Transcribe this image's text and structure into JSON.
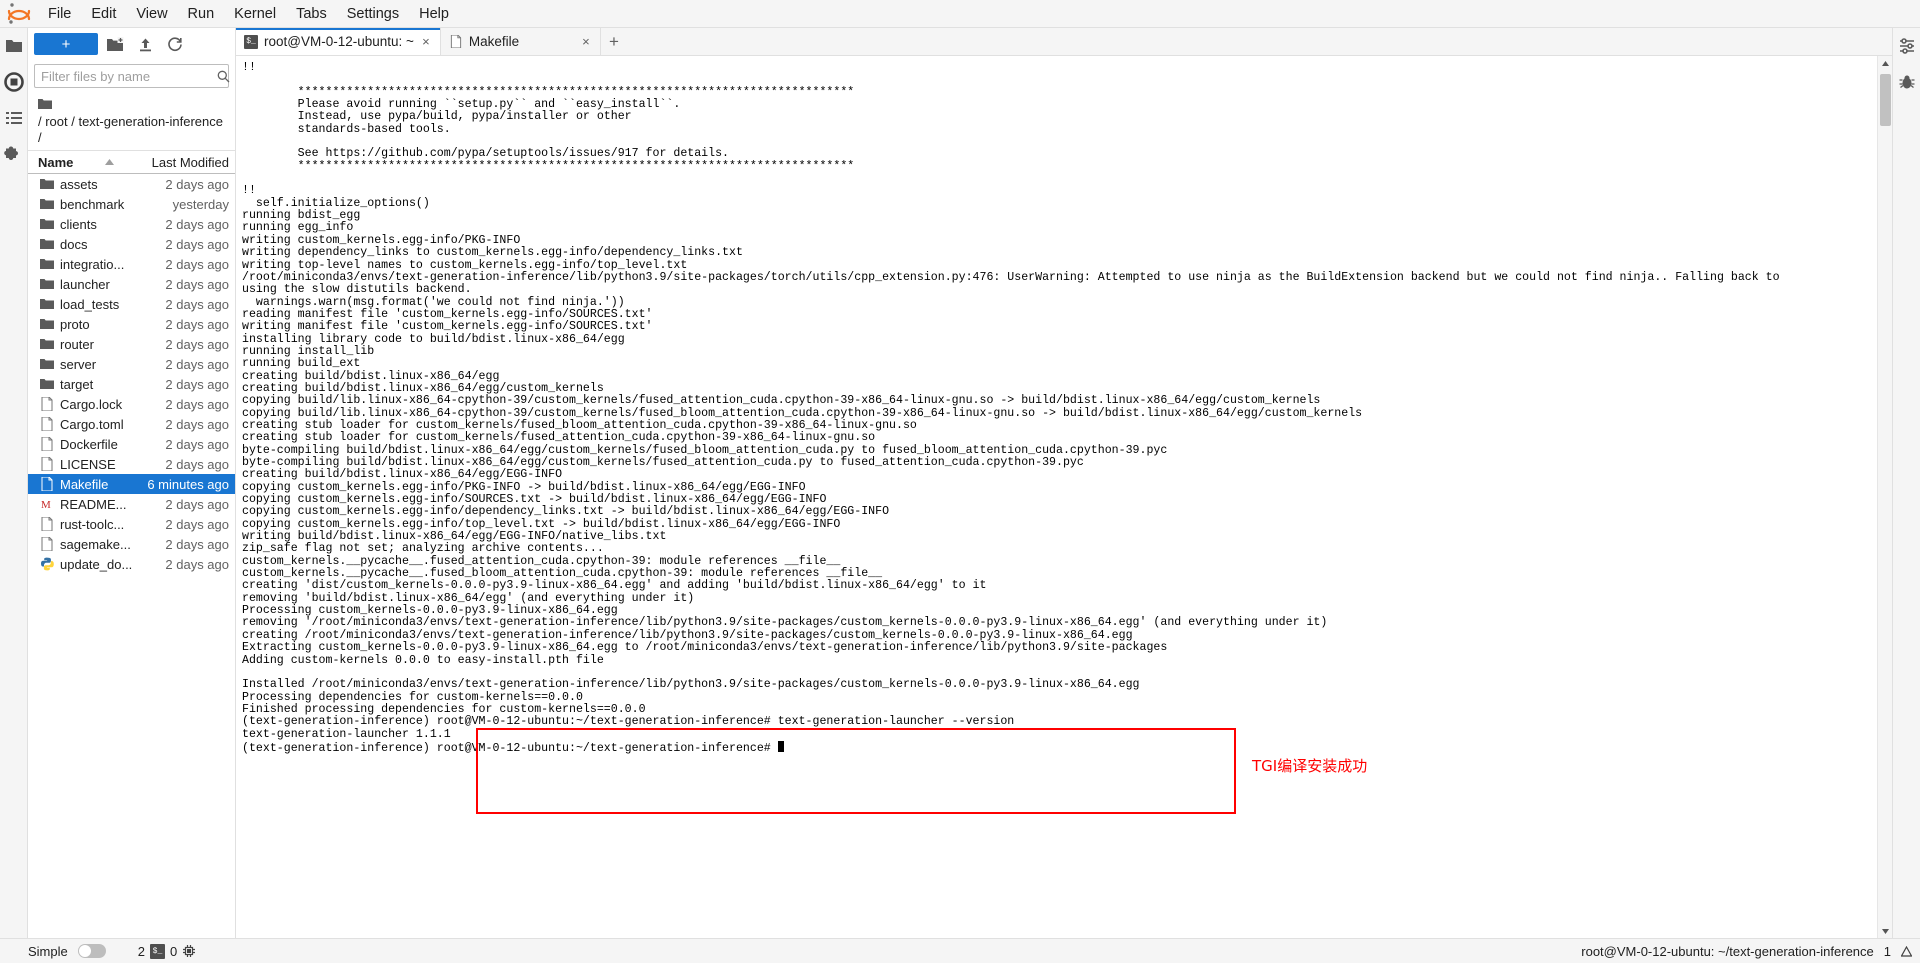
{
  "menubar": {
    "logo_name": "jupyter-logo",
    "items": [
      "File",
      "Edit",
      "View",
      "Run",
      "Kernel",
      "Tabs",
      "Settings",
      "Help"
    ]
  },
  "left_activity_bar": {
    "items": [
      {
        "name": "file-browser-icon",
        "glyph": "folder"
      },
      {
        "name": "running-terminals-icon",
        "glyph": "circle-stop"
      },
      {
        "name": "commands-icon",
        "glyph": "list"
      },
      {
        "name": "extension-manager-icon",
        "glyph": "puzzle"
      }
    ]
  },
  "right_activity_bar": {
    "items": [
      {
        "name": "property-inspector-icon",
        "glyph": "sliders"
      },
      {
        "name": "debugger-icon",
        "glyph": "bug"
      }
    ]
  },
  "file_browser": {
    "new_launcher_label": "+",
    "toolbar_icons": [
      "new-folder-icon",
      "upload-icon",
      "refresh-icon"
    ],
    "filter_placeholder": "Filter files by name",
    "filter_value": "",
    "breadcrumb": "/ root / text-generation-inference /",
    "columns": {
      "name": "Name",
      "last_modified": "Last Modified"
    },
    "sort_indicator": "ascending",
    "items": [
      {
        "name": "assets",
        "modified": "2 days ago",
        "type": "folder",
        "selected": false
      },
      {
        "name": "benchmark",
        "modified": "yesterday",
        "type": "folder",
        "selected": false
      },
      {
        "name": "clients",
        "modified": "2 days ago",
        "type": "folder",
        "selected": false
      },
      {
        "name": "docs",
        "modified": "2 days ago",
        "type": "folder",
        "selected": false
      },
      {
        "name": "integratio...",
        "modified": "2 days ago",
        "type": "folder",
        "selected": false
      },
      {
        "name": "launcher",
        "modified": "2 days ago",
        "type": "folder",
        "selected": false
      },
      {
        "name": "load_tests",
        "modified": "2 days ago",
        "type": "folder",
        "selected": false
      },
      {
        "name": "proto",
        "modified": "2 days ago",
        "type": "folder",
        "selected": false
      },
      {
        "name": "router",
        "modified": "2 days ago",
        "type": "folder",
        "selected": false
      },
      {
        "name": "server",
        "modified": "2 days ago",
        "type": "folder",
        "selected": false
      },
      {
        "name": "target",
        "modified": "2 days ago",
        "type": "folder",
        "selected": false
      },
      {
        "name": "Cargo.lock",
        "modified": "2 days ago",
        "type": "file",
        "selected": false
      },
      {
        "name": "Cargo.toml",
        "modified": "2 days ago",
        "type": "file",
        "selected": false
      },
      {
        "name": "Dockerfile",
        "modified": "2 days ago",
        "type": "file",
        "selected": false
      },
      {
        "name": "LICENSE",
        "modified": "2 days ago",
        "type": "file",
        "selected": false
      },
      {
        "name": "Makefile",
        "modified": "6 minutes ago",
        "type": "file",
        "selected": true
      },
      {
        "name": "README...",
        "modified": "2 days ago",
        "type": "markdown",
        "selected": false
      },
      {
        "name": "rust-toolc...",
        "modified": "2 days ago",
        "type": "file",
        "selected": false
      },
      {
        "name": "sagemake...",
        "modified": "2 days ago",
        "type": "file",
        "selected": false
      },
      {
        "name": "update_do...",
        "modified": "2 days ago",
        "type": "python",
        "selected": false
      }
    ]
  },
  "tabs": [
    {
      "label": "root@VM-0-12-ubuntu: ~",
      "icon": "terminal-icon",
      "active": true,
      "close": "×"
    },
    {
      "label": "Makefile",
      "icon": "file-icon",
      "active": false,
      "close": "×"
    }
  ],
  "new_tab_label": "+",
  "terminal": {
    "lines": [
      "!!",
      "",
      "        ********************************************************************************",
      "        Please avoid running ``setup.py`` and ``easy_install``.",
      "        Instead, use pypa/build, pypa/installer or other",
      "        standards-based tools.",
      "",
      "        See https://github.com/pypa/setuptools/issues/917 for details.",
      "        ********************************************************************************",
      "",
      "!!",
      "  self.initialize_options()",
      "running bdist_egg",
      "running egg_info",
      "writing custom_kernels.egg-info/PKG-INFO",
      "writing dependency_links to custom_kernels.egg-info/dependency_links.txt",
      "writing top-level names to custom_kernels.egg-info/top_level.txt",
      "/root/miniconda3/envs/text-generation-inference/lib/python3.9/site-packages/torch/utils/cpp_extension.py:476: UserWarning: Attempted to use ninja as the BuildExtension backend but we could not find ninja.. Falling back to",
      "using the slow distutils backend.",
      "  warnings.warn(msg.format('we could not find ninja.'))",
      "reading manifest file 'custom_kernels.egg-info/SOURCES.txt'",
      "writing manifest file 'custom_kernels.egg-info/SOURCES.txt'",
      "installing library code to build/bdist.linux-x86_64/egg",
      "running install_lib",
      "running build_ext",
      "creating build/bdist.linux-x86_64/egg",
      "creating build/bdist.linux-x86_64/egg/custom_kernels",
      "copying build/lib.linux-x86_64-cpython-39/custom_kernels/fused_attention_cuda.cpython-39-x86_64-linux-gnu.so -> build/bdist.linux-x86_64/egg/custom_kernels",
      "copying build/lib.linux-x86_64-cpython-39/custom_kernels/fused_bloom_attention_cuda.cpython-39-x86_64-linux-gnu.so -> build/bdist.linux-x86_64/egg/custom_kernels",
      "creating stub loader for custom_kernels/fused_bloom_attention_cuda.cpython-39-x86_64-linux-gnu.so",
      "creating stub loader for custom_kernels/fused_attention_cuda.cpython-39-x86_64-linux-gnu.so",
      "byte-compiling build/bdist.linux-x86_64/egg/custom_kernels/fused_bloom_attention_cuda.py to fused_bloom_attention_cuda.cpython-39.pyc",
      "byte-compiling build/bdist.linux-x86_64/egg/custom_kernels/fused_attention_cuda.py to fused_attention_cuda.cpython-39.pyc",
      "creating build/bdist.linux-x86_64/egg/EGG-INFO",
      "copying custom_kernels.egg-info/PKG-INFO -> build/bdist.linux-x86_64/egg/EGG-INFO",
      "copying custom_kernels.egg-info/SOURCES.txt -> build/bdist.linux-x86_64/egg/EGG-INFO",
      "copying custom_kernels.egg-info/dependency_links.txt -> build/bdist.linux-x86_64/egg/EGG-INFO",
      "copying custom_kernels.egg-info/top_level.txt -> build/bdist.linux-x86_64/egg/EGG-INFO",
      "writing build/bdist.linux-x86_64/egg/EGG-INFO/native_libs.txt",
      "zip_safe flag not set; analyzing archive contents...",
      "custom_kernels.__pycache__.fused_attention_cuda.cpython-39: module references __file__",
      "custom_kernels.__pycache__.fused_bloom_attention_cuda.cpython-39: module references __file__",
      "creating 'dist/custom_kernels-0.0.0-py3.9-linux-x86_64.egg' and adding 'build/bdist.linux-x86_64/egg' to it",
      "removing 'build/bdist.linux-x86_64/egg' (and everything under it)",
      "Processing custom_kernels-0.0.0-py3.9-linux-x86_64.egg",
      "removing '/root/miniconda3/envs/text-generation-inference/lib/python3.9/site-packages/custom_kernels-0.0.0-py3.9-linux-x86_64.egg' (and everything under it)",
      "creating /root/miniconda3/envs/text-generation-inference/lib/python3.9/site-packages/custom_kernels-0.0.0-py3.9-linux-x86_64.egg",
      "Extracting custom_kernels-0.0.0-py3.9-linux-x86_64.egg to /root/miniconda3/envs/text-generation-inference/lib/python3.9/site-packages",
      "Adding custom-kernels 0.0.0 to easy-install.pth file",
      "",
      "Installed /root/miniconda3/envs/text-generation-inference/lib/python3.9/site-packages/custom_kernels-0.0.0-py3.9-linux-x86_64.egg",
      "Processing dependencies for custom-kernels==0.0.0",
      "Finished processing dependencies for custom-kernels==0.0.0",
      "(text-generation-inference) root@VM-0-12-ubuntu:~/text-generation-inference# text-generation-launcher --version",
      "text-generation-launcher 1.1.1",
      "(text-generation-inference) root@VM-0-12-ubuntu:~/text-generation-inference# "
    ],
    "highlight_color": "#ff0000",
    "annotation": "TGI编译安装成功"
  },
  "statusbar": {
    "mode_label": "Simple",
    "mode_enabled": false,
    "kernel_count": "2",
    "terminal_icon": "terminal-icon",
    "notebook_count": "0",
    "resource_icon": "cpu-icon",
    "right_text": "root@VM-0-12-ubuntu: ~/text-generation-inference",
    "right_count": "1",
    "right_icon": "triangle-icon"
  }
}
